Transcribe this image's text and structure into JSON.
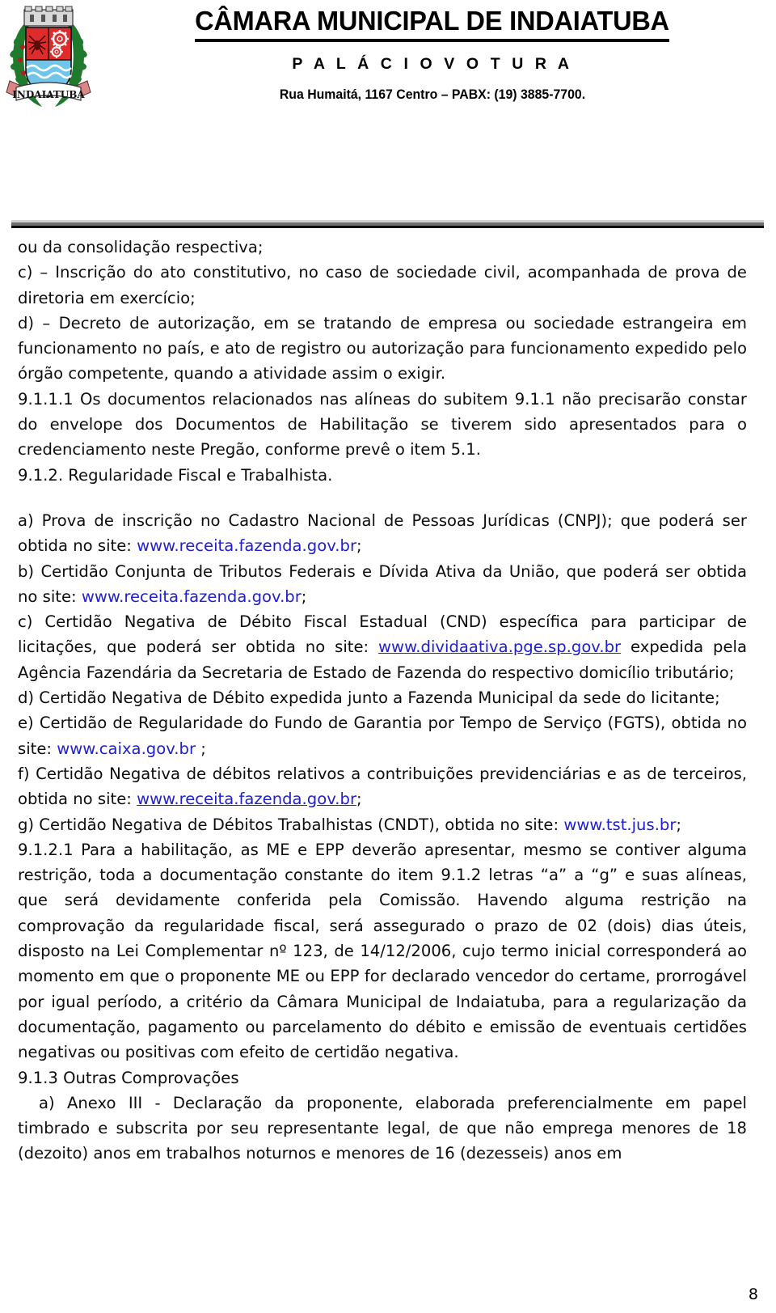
{
  "header": {
    "org_title": "CÂMARA MUNICIPAL DE INDAIATUBA",
    "palace_line": "P A L Á C I O  V O T U R A",
    "address_line": "Rua Humaitá, 1167 Centro – PABX: (19) 3885-7700.",
    "crest_banner_text": "INDAIATUBA",
    "crest_colors": {
      "shield_upper": "#e02b2b",
      "shield_lower": "#6fc6e8",
      "wreath": "#1f7a2e",
      "banner": "#ffffff",
      "crown": "#d8d8d8"
    }
  },
  "colors": {
    "text": "#0d0d0d",
    "link": "#2020cf",
    "rule_light": "#cfcfcf",
    "rule_mid": "#6e6e6e",
    "rule_dark": "#0a0a0a"
  },
  "body": {
    "line_ou": "ou  da consolidação respectiva;",
    "item_c": "c) – Inscrição do ato constitutivo, no caso de sociedade civil, acompanhada de prova de diretoria em exercício;",
    "item_d": "d) – Decreto de autorização, em se tratando de empresa ou sociedade estrangeira em funcionamento no país, e ato de registro ou autorização para funcionamento expedido pelo órgão competente, quando a atividade assim o exigir.",
    "item_9111": "9.1.1.1 Os documentos relacionados nas alíneas do subitem 9.1.1 não precisarão constar do envelope dos Documentos de Habilitação se tiverem sido apresentados para o  credenciamento neste Pregão, conforme prevê o item 5.1.",
    "item_912": "9.1.2. Regularidade Fiscal e Trabalhista.",
    "item_a_pre": "a) Prova de inscrição no Cadastro Nacional de Pessoas Jurídicas (CNPJ); que poderá ser obtida no site: ",
    "item_a_link": "www.receita.fazenda.gov.br",
    "item_a_post": ";",
    "item_b_pre": "b) Certidão Conjunta de Tributos Federais e Dívida Ativa da União, que poderá ser obtida no site: ",
    "item_b_link": "www.receita.fazenda.gov.br",
    "item_b_post": ";",
    "item_c2_pre": "c) Certidão Negativa de Débito Fiscal Estadual (CND) específica para participar de licitações, que poderá ser obtida no site: ",
    "item_c2_link": "www.dividaativa.pge.sp.gov.br",
    "item_c2_post": " expedida pela Agência Fazendária da Secretaria de Estado de Fazenda do respectivo domicílio tributário;",
    "item_d2": "d) Certidão Negativa de Débito expedida junto a Fazenda Municipal da sede do licitante;",
    "item_e_pre": "e) Certidão de Regularidade do Fundo de Garantia por Tempo de Serviço (FGTS), obtida no site: ",
    "item_e_link": "www.caixa.gov.br",
    "item_e_post": " ;",
    "item_f_pre": "f) Certidão Negativa de débitos relativos a contribuições previdenciárias e as de terceiros, obtida no site: ",
    "item_f_link": "www.receita.fazenda.gov.br",
    "item_f_post": ";",
    "item_g_pre": "g) Certidão Negativa de Débitos Trabalhistas (CNDT), obtida no site: ",
    "item_g_link": "www.tst.jus.br",
    "item_g_post": ";",
    "item_9121": "9.1.2.1 Para a habilitação, as ME e EPP deverão apresentar, mesmo se contiver alguma restrição, toda a documentação constante do item 9.1.2 letras “a” a “g” e suas alíneas, que será devidamente conferida pela Comissão. Havendo alguma restrição na comprovação da regularidade fiscal, será assegurado o prazo de 02 (dois) dias úteis, disposto na  Lei Complementar nº 123, de 14/12/2006, cujo termo inicial corresponderá ao momento em que o proponente ME ou EPP for declarado vencedor do certame, prorrogável por igual período, a critério da Câmara Municipal de Indaiatuba, para a regularização da documentação, pagamento ou parcelamento do débito e emissão de eventuais certidões negativas ou positivas com efeito de certidão negativa.",
    "item_913": "9.1.3 Outras Comprovações",
    "item_a3": "a) Anexo III - Declaração da proponente, elaborada preferencialmente em papel timbrado e subscrita por seu representante legal, de que não emprega menores de 18 (dezoito) anos em trabalhos noturnos e menores de 16 (dezesseis) anos em"
  },
  "footer": {
    "page_number": "8"
  }
}
